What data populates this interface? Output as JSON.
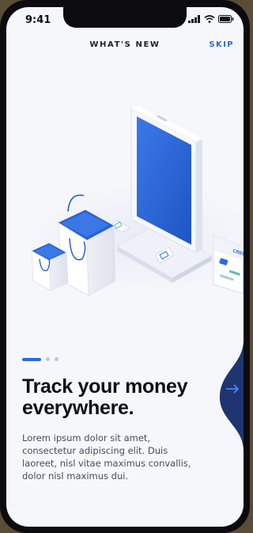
{
  "status_bar": {
    "time": "9:41",
    "icons": [
      "signal-icon",
      "wifi-icon",
      "battery-icon"
    ]
  },
  "header": {
    "title": "WHAT'S NEW",
    "skip_label": "SKIP"
  },
  "illustration": {
    "card_label": "CREDIT",
    "colors": {
      "accent": "#2a6be0",
      "screen_blue": "#2f68d8"
    }
  },
  "pager": {
    "total": 3,
    "active_index": 0
  },
  "content": {
    "headline": "Track your money everywhere.",
    "body": "Lorem ipsum dolor sit amet, consectetur adipiscing elit. Duis laoreet, nisl vitae maximus convallis, dolor nisl maximus dui."
  },
  "next_button": {
    "icon": "arrow-right-icon",
    "color": "#1f3570"
  }
}
